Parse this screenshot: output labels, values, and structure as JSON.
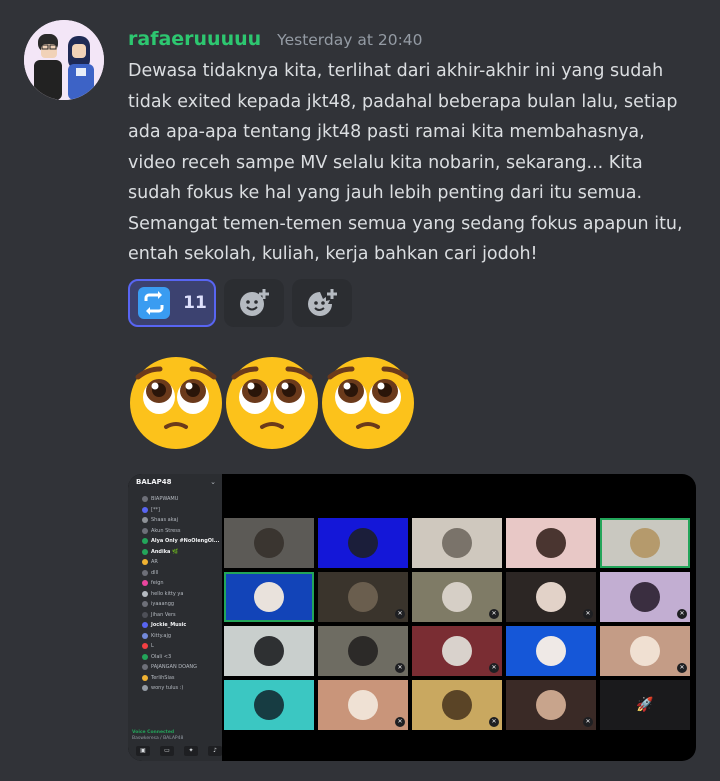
{
  "message": {
    "author": "rafaeruuuuu",
    "timestamp": "Yesterday at 20:40",
    "text": "Dewasa tidaknya kita, terlihat dari akhir-akhir ini yang sudah\ntidak exited kepada jkt48, padahal beberapa bulan lalu, setiap\nada apa-apa tentang jkt48 pasti ramai kita membahasnya,\nvideo receh sampe MV selalu kita nobarin, sekarang... Kita\nsudah fokus ke hal yang jauh lebih penting dari itu semua.\nSemangat temen-temen semua yang sedang fokus apapun itu,\nentah sekolah, kuliah, kerja bahkan cari jodoh!",
    "reactions": [
      {
        "icon": "repeat-arrows-icon",
        "count": "11",
        "active": true
      },
      {
        "icon": "add-reaction-icon"
      },
      {
        "icon": "add-super-reaction-icon"
      }
    ],
    "emoji_row": [
      "pleading-face-icon",
      "pleading-face-icon",
      "pleading-face-icon"
    ]
  },
  "attachment": {
    "server_name": "BALAP48",
    "members": [
      {
        "name": "BIAPWAMU",
        "color": "#6d6f78"
      },
      {
        "name": "[**]",
        "color": "#5865f2"
      },
      {
        "name": "Shaas akaj",
        "color": "#8e9297"
      },
      {
        "name": "Akun Stress",
        "color": "#6d6f78"
      },
      {
        "name": "Alya Only #NoOlengOl...",
        "color": "#23a55a",
        "bold": true
      },
      {
        "name": "Andika 🌿",
        "color": "#23a55a",
        "bold": true
      },
      {
        "name": "AR",
        "color": "#f0b232"
      },
      {
        "name": "dlll",
        "color": "#6d6f78"
      },
      {
        "name": "feign",
        "color": "#eb459e"
      },
      {
        "name": "hello kitty ya",
        "color": "#b5bac1"
      },
      {
        "name": "iyaaangg",
        "color": "#6d6f78"
      },
      {
        "name": "Jihan Vers",
        "color": "#4e5058"
      },
      {
        "name": "Jockie_Music",
        "color": "#5865f2",
        "bold": true
      },
      {
        "name": "Kitty.ajg",
        "color": "#7289da"
      },
      {
        "name": "L",
        "color": "#f23f43"
      },
      {
        "name": "Olali <3",
        "color": "#23a55a"
      },
      {
        "name": "PAJANGAN DOANG",
        "color": "#6d6f78"
      },
      {
        "name": "TerlihSias",
        "color": "#f0b232"
      },
      {
        "name": "wony tulus :)",
        "color": "#949ba4"
      }
    ],
    "voice_status": "Voice Connected",
    "voice_channel": "Baswkeresa / BALAP48",
    "tiles": [
      {
        "bg": "#5c5a56",
        "av": "#3a3530"
      },
      {
        "bg": "#1417d8",
        "av": "#1b1e3a"
      },
      {
        "bg": "#cfc8be",
        "av": "#7a736a"
      },
      {
        "bg": "#e8c8c6",
        "av": "#4a3530"
      },
      {
        "bg": "#c9c8c0",
        "av": "#b59a6c",
        "speaking": true
      },
      {
        "bg": "#1244b8",
        "av": "#e9e2dc",
        "speaking": true
      },
      {
        "bg": "#3a342c",
        "av": "#6a5e4e",
        "muted": true
      },
      {
        "bg": "#7f7b66",
        "av": "#d6cfc6",
        "muted": true
      },
      {
        "bg": "#2c2624",
        "av": "#e2d2c8",
        "muted": true
      },
      {
        "bg": "#c2aed2",
        "av": "#3a2e40",
        "muted": true
      },
      {
        "bg": "#c9cfcd",
        "av": "#2e3032"
      },
      {
        "bg": "#6e6c62",
        "av": "#2c2a28",
        "muted": true
      },
      {
        "bg": "#7a2d33",
        "av": "#d9d2cc",
        "muted": true
      },
      {
        "bg": "#1557d8",
        "av": "#efe9e6"
      },
      {
        "bg": "#c49c86",
        "av": "#f0e0d2",
        "muted": true
      },
      {
        "bg": "#3bc7c2",
        "av": "#173c42"
      },
      {
        "bg": "#c9957a",
        "av": "#efe1d4",
        "muted": true
      },
      {
        "bg": "#c9a860",
        "av": "#5a4426",
        "muted": true
      },
      {
        "bg": "#3a2a26",
        "av": "#c8a48c",
        "muted": true
      },
      {
        "bg": "#1a1a1c",
        "av": "",
        "extra": "rocket-icon"
      }
    ]
  }
}
